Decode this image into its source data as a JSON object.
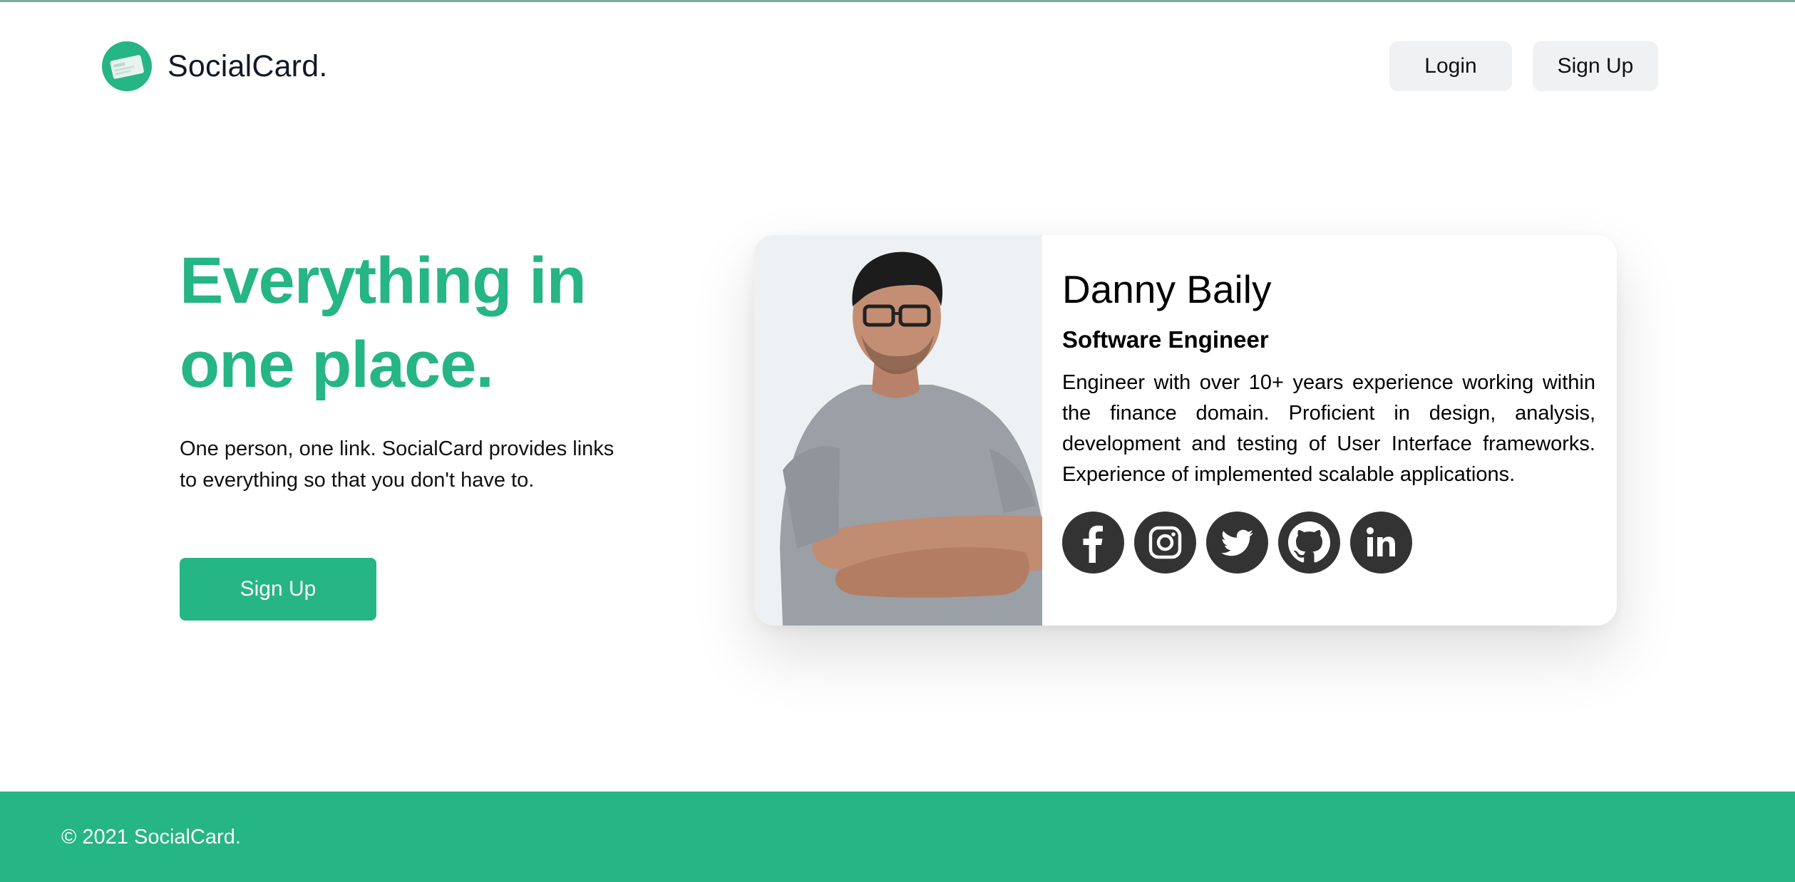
{
  "header": {
    "brand": "SocialCard.",
    "login_label": "Login",
    "signup_label": "Sign Up"
  },
  "hero": {
    "title_line1": "Everything in",
    "title_line2": "one place.",
    "description": "One person, one link. SocialCard provides links to everything so that you don't have to.",
    "cta_label": "Sign Up"
  },
  "card": {
    "name": "Danny Baily",
    "role": "Software Engineer",
    "bio": "Engineer with over 10+ years experience working within the finance domain. Proficient in design, analysis, development and testing of User Interface frameworks. Experience of implemented scalable applications.",
    "socials": [
      "facebook-icon",
      "instagram-icon",
      "twitter-icon",
      "github-icon",
      "linkedin-icon"
    ]
  },
  "footer": {
    "copyright": "© 2021 SocialCard."
  },
  "colors": {
    "accent": "#26b584",
    "social_bg": "#333333",
    "nav_button_bg": "#f0f1f3"
  }
}
